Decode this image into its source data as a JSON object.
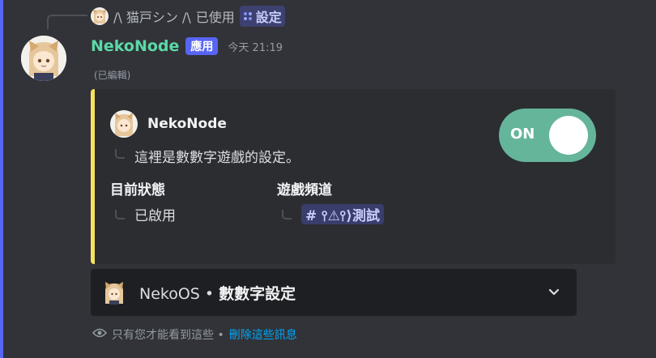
{
  "reply": {
    "user": "/\\ 猫戸シン /\\",
    "action": "已使用",
    "command": "設定"
  },
  "message": {
    "username": "NekoNode",
    "badge": "應用",
    "timestamp": "今天 21:19",
    "edited": "(已編輯)"
  },
  "embed": {
    "accent_color": "#f4e25c",
    "author": "NekoNode",
    "description": "這裡是數數字遊戲的設定。",
    "fields": [
      {
        "name": "目前狀態",
        "value": "已啟用"
      },
      {
        "name": "遊戲頻道",
        "value": "⫯⚠⫯⟩測試"
      }
    ],
    "toggle": {
      "label": "ON",
      "color": "#65b59b"
    }
  },
  "select_menu": {
    "prefix": "NekoOS •",
    "title": "數數字設定"
  },
  "ephemeral": {
    "text": "只有您才能看到這些 •",
    "dismiss": "刪除這些訊息"
  },
  "icons": {
    "reply_command": "slash-command-icon",
    "chevron": "chevron-down-icon",
    "eye": "eye-icon",
    "channel": "hashtag-icon"
  }
}
